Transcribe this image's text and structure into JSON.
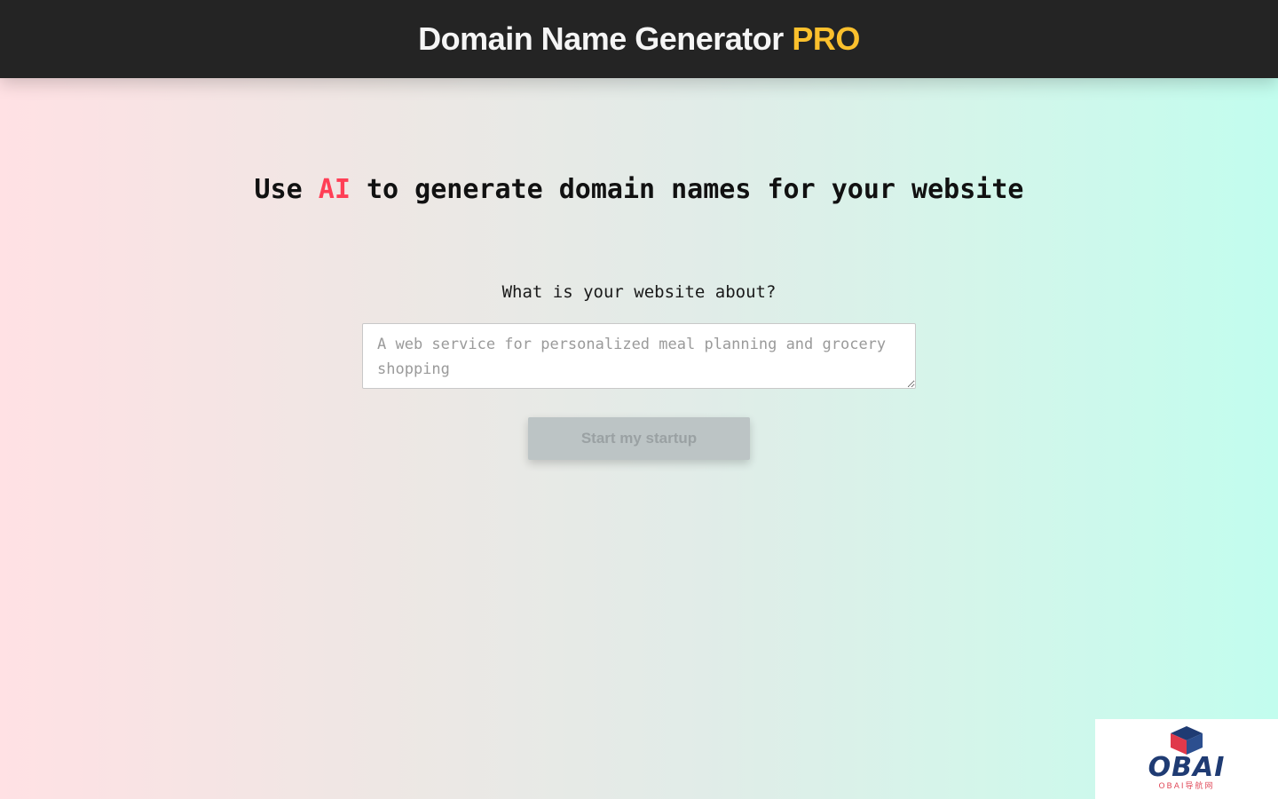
{
  "header": {
    "title": "Domain Name Generator",
    "title_accent": "PRO",
    "accent_color": "#fbc02d"
  },
  "main": {
    "headline_pre": "Use",
    "headline_ai": "AI",
    "headline_post": "to generate domain names for your website",
    "ai_color": "#ff3f56",
    "question": "What is your website about?",
    "input": {
      "value": "",
      "placeholder": "A web service for personalized meal planning and grocery shopping"
    },
    "submit_label": "Start my startup"
  },
  "watermark": {
    "brand": "OBAI",
    "subtitle": "OBAI导航网",
    "icon": "cube-logo-icon"
  }
}
